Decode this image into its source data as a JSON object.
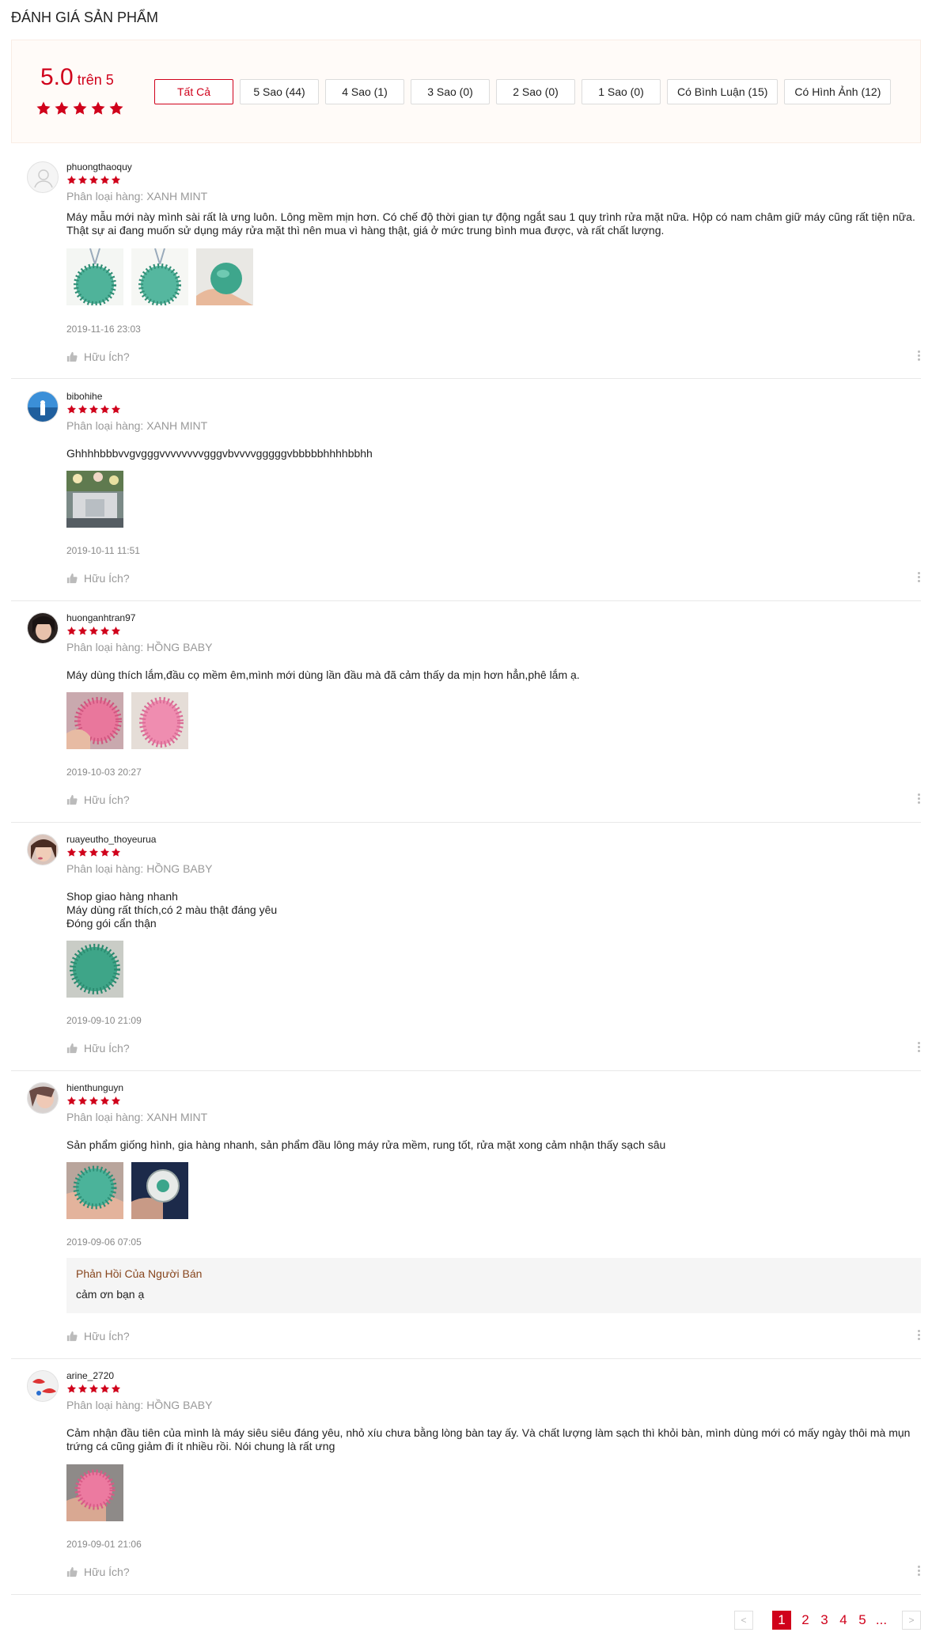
{
  "section_title": "ĐÁNH GIÁ SẢN PHẨM",
  "overview": {
    "score": "5.0",
    "out_of": " trên 5",
    "rating": 5,
    "filters": [
      "Tất Cả",
      "5 Sao (44)",
      "4 Sao (1)",
      "3 Sao (0)",
      "2 Sao (0)",
      "1 Sao (0)",
      "Có Bình Luận (15)",
      "Có Hình Ảnh (12)"
    ]
  },
  "colors": {
    "accent": "#d0011b",
    "reply_header": "#87461e"
  },
  "helpful_label": "Hữu Ích?",
  "reviews": [
    {
      "username": "phuongthaoquy",
      "rating": 5,
      "variant": "Phân loại hàng: XANH MINT",
      "comment": [
        "Máy mẫu mới này mình sài rất là ưng luôn. Lông mềm mịn hơn. Có chế độ thời gian tự động ngắt sau 1 quy trình rửa mặt nữa. Hộp có nam châm giữ máy cũng rất tiện nữa. Thật sự ai đang muốn sử dụng máy rửa mặt thì nên mua vì hàng thật, giá ở mức trung bình mua được, và rất chất lượng."
      ],
      "date": "2019-11-16 23:03"
    },
    {
      "username": "bibohihe",
      "rating": 5,
      "variant": "Phân loại hàng: XANH MINT",
      "comment": [
        "Ghhhhbbbvvgvgggvvvvvvvvgggvbvvvvgggggvbbbbbhhhhbbhh"
      ],
      "date": "2019-10-11 11:51"
    },
    {
      "username": "huonganhtran97",
      "rating": 5,
      "variant": "Phân loại hàng: HỒNG BABY",
      "comment": [
        "Máy dùng thích lắm,đầu cọ mềm êm,mình mới dùng lần đầu mà đã cảm thấy da mịn hơn hẳn,phê lắm ạ."
      ],
      "date": "2019-10-03 20:27"
    },
    {
      "username": "ruayeutho_thoyeurua",
      "rating": 5,
      "variant": "Phân loại hàng: HỒNG BABY",
      "comment": [
        "Shop giao hàng nhanh",
        "Máy dùng rất thích,có 2 màu thật đáng yêu",
        "Đóng gói cẩn thận"
      ],
      "date": "2019-09-10 21:09"
    },
    {
      "username": "hienthunguyn",
      "rating": 5,
      "variant": "Phân loại hàng: XANH MINT",
      "comment": [
        "Sản phẩm giống hình, gia hàng nhanh, sản phẩm đầu lông máy rửa mềm, rung tốt, rửa mặt xong cảm nhận thấy sạch sâu"
      ],
      "date": "2019-09-06 07:05",
      "seller_reply": {
        "header": "Phản Hồi Của Người Bán",
        "text": "cảm ơn bạn ạ"
      }
    },
    {
      "username": "arine_2720",
      "rating": 5,
      "variant": "Phân loại hàng: HỒNG BABY",
      "comment": [
        "Cảm nhận đầu tiên của mình là máy siêu siêu đáng yêu, nhỏ xíu chưa bằng lòng bàn tay ấy. Và chất lượng làm sạch thì khỏi bàn, mình dùng mới có mấy ngày thôi mà mụn trứng cá cũng giảm đi ít nhiều rồi. Nói chung là rất ưng"
      ],
      "date": "2019-09-01 21:06"
    }
  ],
  "pagination": {
    "prev": "<",
    "next": ">",
    "pages": [
      "1",
      "2",
      "3",
      "4",
      "5",
      "..."
    ],
    "current": "1"
  }
}
